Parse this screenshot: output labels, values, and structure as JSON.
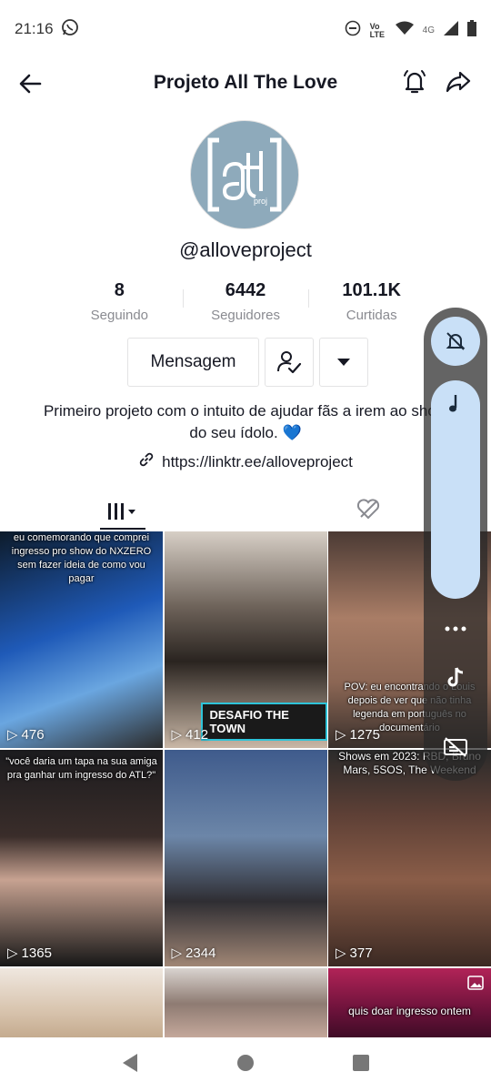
{
  "status_bar": {
    "time": "21:16",
    "network": "4G",
    "volte": "Vo LTE"
  },
  "header": {
    "title": "Projeto All The Love"
  },
  "profile": {
    "avatar_text": "atl",
    "avatar_subtext": "project",
    "username": "@alloveproject",
    "stats": [
      {
        "value": "8",
        "label": "Seguindo"
      },
      {
        "value": "6442",
        "label": "Seguidores"
      },
      {
        "value": "101.1K",
        "label": "Curtidas"
      }
    ],
    "message_button": "Mensagem",
    "bio": "Primeiro projeto com o intuito de ajudar fãs a irem ao show do seu ídolo. 💙",
    "link": "https://linktr.ee/alloveproject"
  },
  "videos": [
    {
      "caption": "eu comemorando que comprei ingresso pro show do NXZERO sem fazer ideia de como vou pagar",
      "views": "476"
    },
    {
      "caption": "",
      "banner": "DESAFIO THE TOWN",
      "views": "412"
    },
    {
      "caption": "POV: eu encontrando o Louis depois de ver que não tinha legenda em português no documentário",
      "views": "1275"
    },
    {
      "caption": "\"você daria um tapa na sua amiga pra ganhar um ingresso do ATL?\"",
      "views": "1365"
    },
    {
      "caption": "",
      "views": "2344"
    },
    {
      "caption": "Shows em 2023: RBD, Bruno Mars, 5SOS, The Weekend",
      "views": "377"
    },
    {
      "caption": "",
      "views": ""
    },
    {
      "caption": "",
      "views": ""
    },
    {
      "caption": "quis doar ingresso ontem",
      "views": ""
    }
  ],
  "colors": {
    "accent": "#161823",
    "panel_blue": "#c9e0f7"
  }
}
